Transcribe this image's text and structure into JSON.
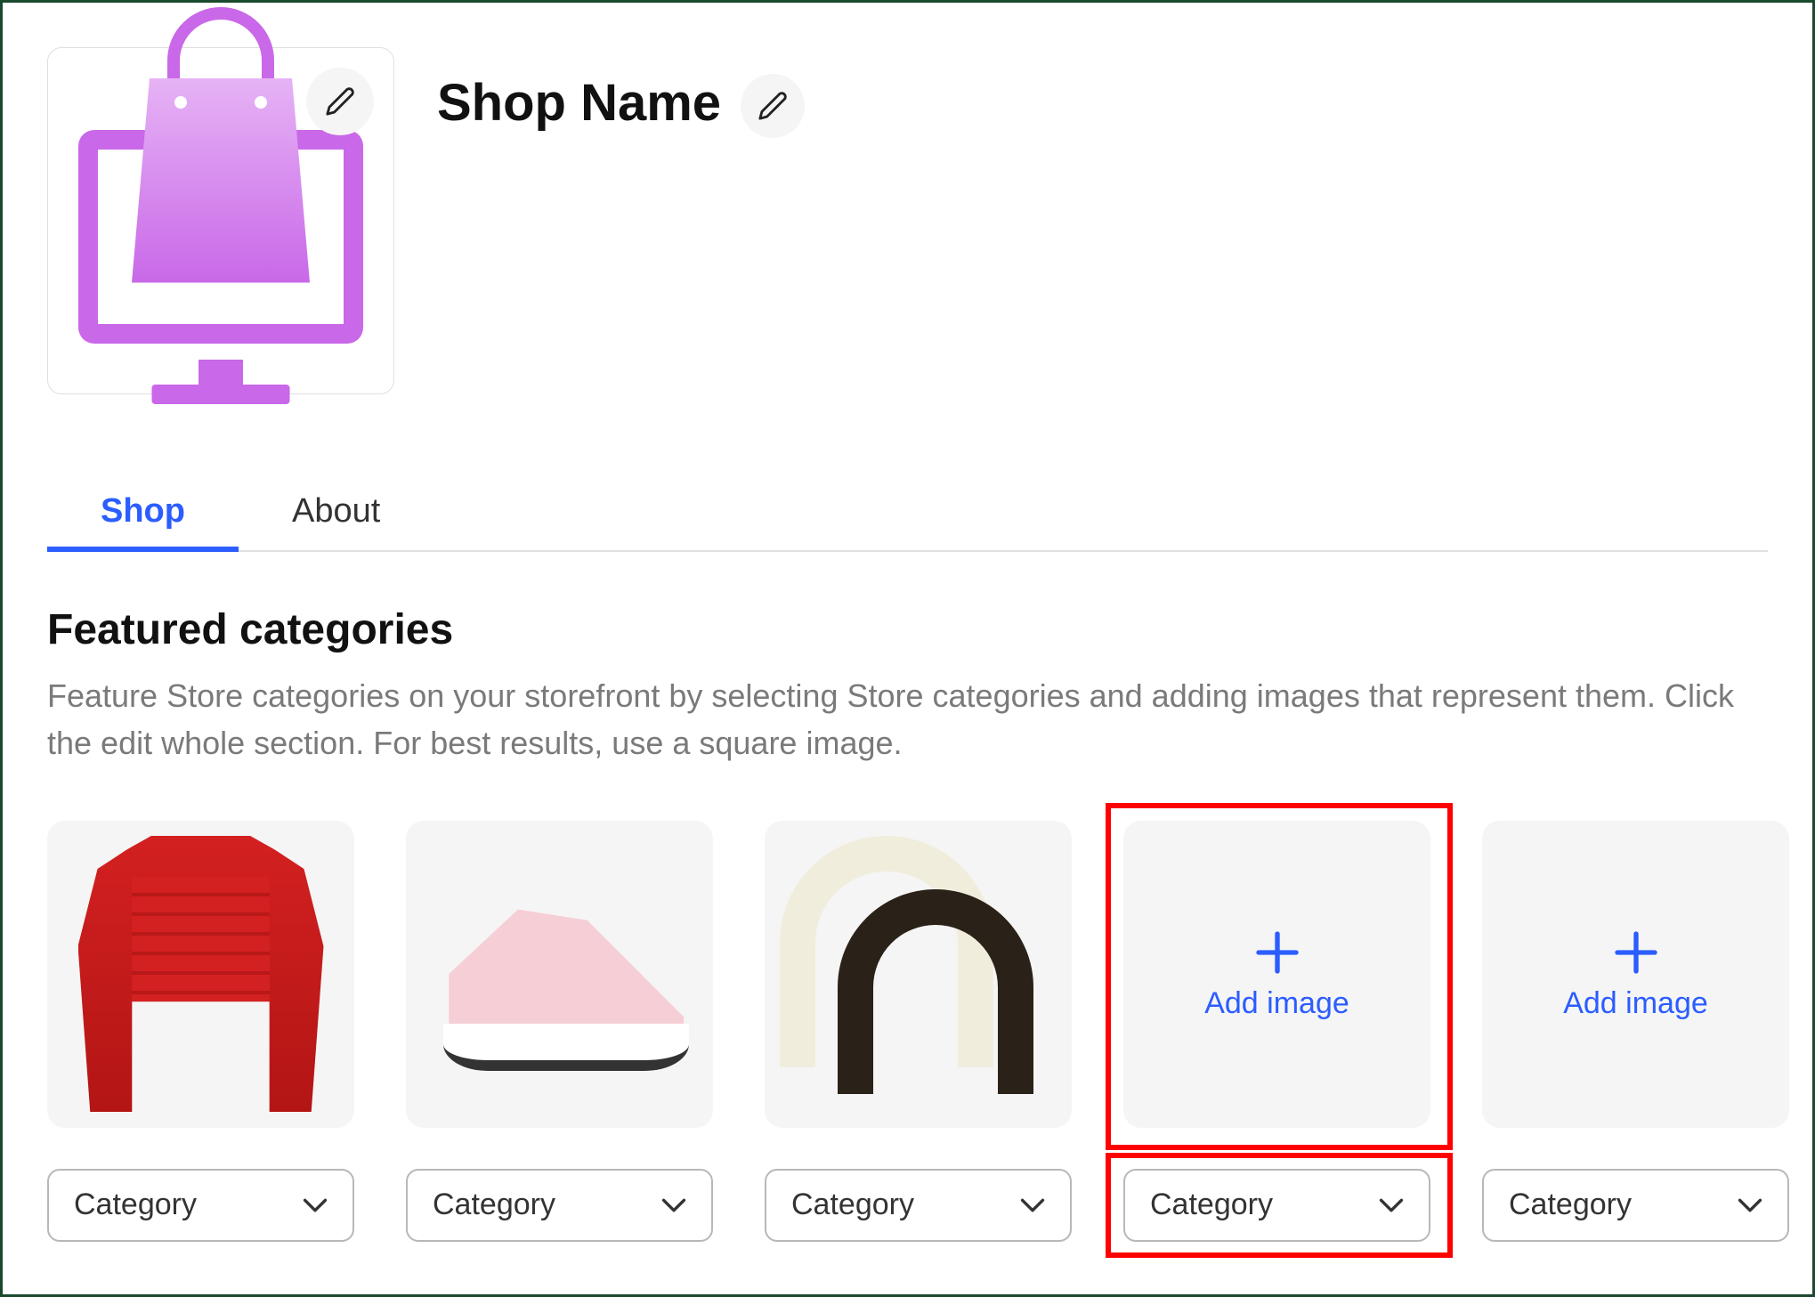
{
  "header": {
    "shop_title": "Shop Name"
  },
  "tabs": [
    {
      "label": "Shop",
      "active": true
    },
    {
      "label": "About",
      "active": false
    }
  ],
  "section": {
    "title": "Featured categories",
    "description": "Feature Store categories on your storefront by selecting Store categories and adding images that represent them. Click the edit whole section. For best results, use a square image."
  },
  "categories": [
    {
      "dropdown_label": "Category",
      "has_image": true,
      "image_desc": "red-jacket"
    },
    {
      "dropdown_label": "Category",
      "has_image": true,
      "image_desc": "pink-sneaker"
    },
    {
      "dropdown_label": "Category",
      "has_image": true,
      "image_desc": "headbands"
    },
    {
      "dropdown_label": "Category",
      "has_image": false,
      "add_label": "Add image",
      "highlighted": true
    },
    {
      "dropdown_label": "Category",
      "has_image": false,
      "add_label": "Add image"
    }
  ]
}
